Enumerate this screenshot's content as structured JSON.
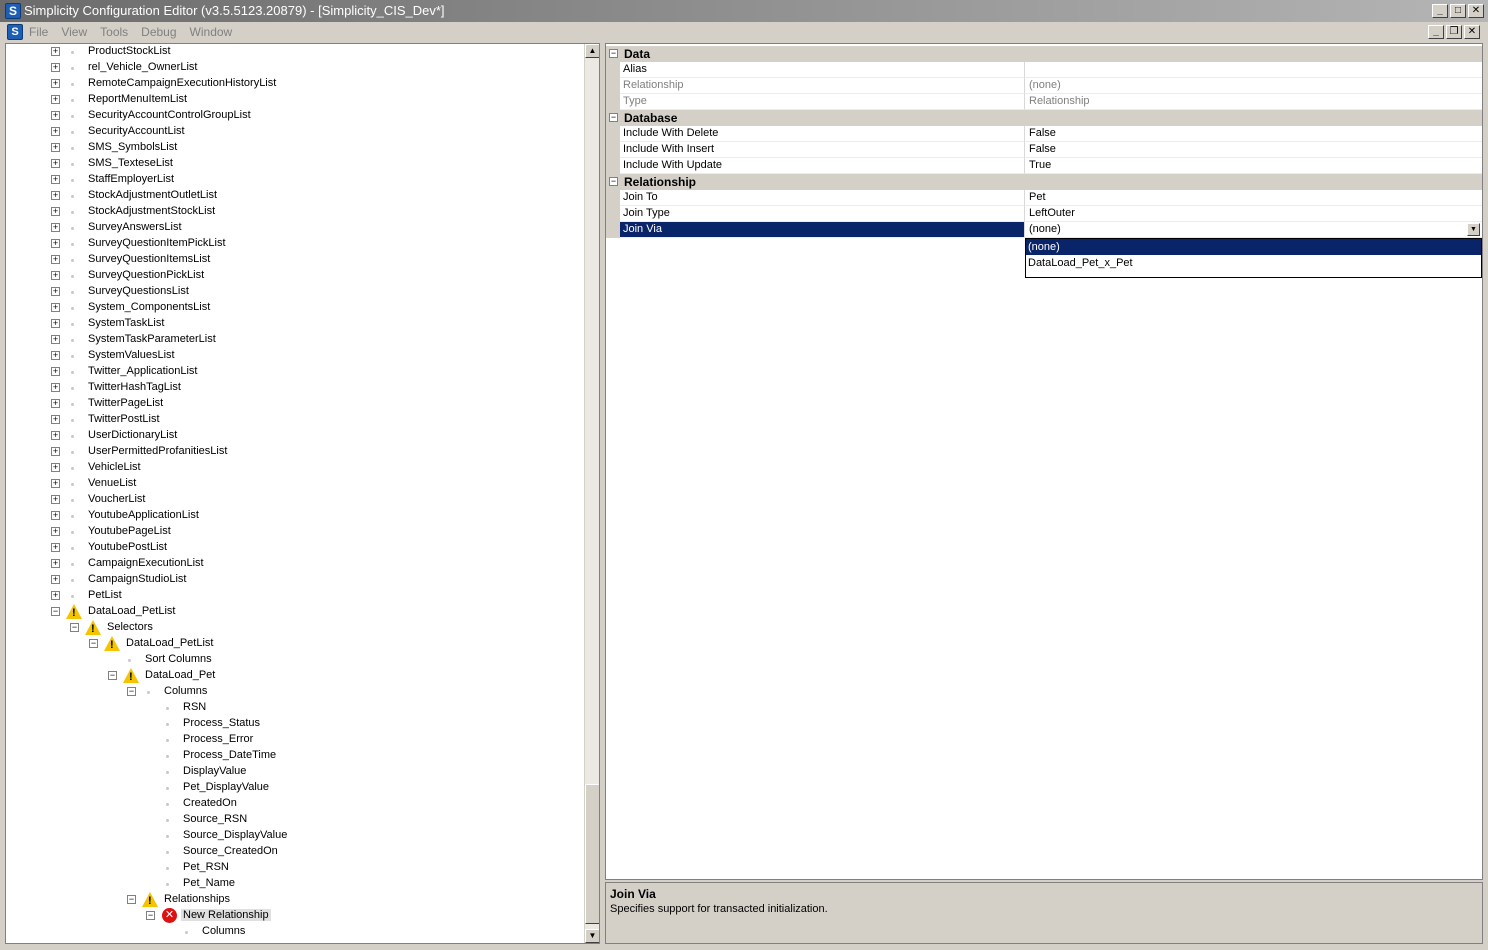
{
  "window": {
    "title": "Simplicity Configuration Editor (v3.5.5123.20879) - [Simplicity_CIS_Dev*]",
    "app_icon_letter": "S",
    "min": "_",
    "max": "□",
    "close": "✕",
    "child_min": "_",
    "child_restore": "❐",
    "child_close": "✕"
  },
  "menu": {
    "file": "File",
    "view": "View",
    "tools": "Tools",
    "debug": "Debug",
    "window": "Window"
  },
  "tree": {
    "expand_sym": "+",
    "collapse_sym": "−",
    "items": [
      {
        "label": "ProductStockList",
        "level": 0,
        "expander": "+",
        "icon": "bullet"
      },
      {
        "label": "rel_Vehicle_OwnerList",
        "level": 0,
        "expander": "+",
        "icon": "bullet"
      },
      {
        "label": "RemoteCampaignExecutionHistoryList",
        "level": 0,
        "expander": "+",
        "icon": "bullet"
      },
      {
        "label": "ReportMenuItemList",
        "level": 0,
        "expander": "+",
        "icon": "bullet"
      },
      {
        "label": "SecurityAccountControlGroupList",
        "level": 0,
        "expander": "+",
        "icon": "bullet"
      },
      {
        "label": "SecurityAccountList",
        "level": 0,
        "expander": "+",
        "icon": "bullet"
      },
      {
        "label": "SMS_SymbolsList",
        "level": 0,
        "expander": "+",
        "icon": "bullet"
      },
      {
        "label": "SMS_TexteseList",
        "level": 0,
        "expander": "+",
        "icon": "bullet"
      },
      {
        "label": "StaffEmployerList",
        "level": 0,
        "expander": "+",
        "icon": "bullet"
      },
      {
        "label": "StockAdjustmentOutletList",
        "level": 0,
        "expander": "+",
        "icon": "bullet"
      },
      {
        "label": "StockAdjustmentStockList",
        "level": 0,
        "expander": "+",
        "icon": "bullet"
      },
      {
        "label": "SurveyAnswersList",
        "level": 0,
        "expander": "+",
        "icon": "bullet"
      },
      {
        "label": "SurveyQuestionItemPickList",
        "level": 0,
        "expander": "+",
        "icon": "bullet"
      },
      {
        "label": "SurveyQuestionItemsList",
        "level": 0,
        "expander": "+",
        "icon": "bullet"
      },
      {
        "label": "SurveyQuestionPickList",
        "level": 0,
        "expander": "+",
        "icon": "bullet"
      },
      {
        "label": "SurveyQuestionsList",
        "level": 0,
        "expander": "+",
        "icon": "bullet"
      },
      {
        "label": "System_ComponentsList",
        "level": 0,
        "expander": "+",
        "icon": "bullet"
      },
      {
        "label": "SystemTaskList",
        "level": 0,
        "expander": "+",
        "icon": "bullet"
      },
      {
        "label": "SystemTaskParameterList",
        "level": 0,
        "expander": "+",
        "icon": "bullet"
      },
      {
        "label": "SystemValuesList",
        "level": 0,
        "expander": "+",
        "icon": "bullet"
      },
      {
        "label": "Twitter_ApplicationList",
        "level": 0,
        "expander": "+",
        "icon": "bullet"
      },
      {
        "label": "TwitterHashTagList",
        "level": 0,
        "expander": "+",
        "icon": "bullet"
      },
      {
        "label": "TwitterPageList",
        "level": 0,
        "expander": "+",
        "icon": "bullet"
      },
      {
        "label": "TwitterPostList",
        "level": 0,
        "expander": "+",
        "icon": "bullet"
      },
      {
        "label": "UserDictionaryList",
        "level": 0,
        "expander": "+",
        "icon": "bullet"
      },
      {
        "label": "UserPermittedProfanitiesList",
        "level": 0,
        "expander": "+",
        "icon": "bullet"
      },
      {
        "label": "VehicleList",
        "level": 0,
        "expander": "+",
        "icon": "bullet"
      },
      {
        "label": "VenueList",
        "level": 0,
        "expander": "+",
        "icon": "bullet"
      },
      {
        "label": "VoucherList",
        "level": 0,
        "expander": "+",
        "icon": "bullet"
      },
      {
        "label": "YoutubeApplicationList",
        "level": 0,
        "expander": "+",
        "icon": "bullet"
      },
      {
        "label": "YoutubePageList",
        "level": 0,
        "expander": "+",
        "icon": "bullet"
      },
      {
        "label": "YoutubePostList",
        "level": 0,
        "expander": "+",
        "icon": "bullet"
      },
      {
        "label": "CampaignExecutionList",
        "level": 0,
        "expander": "+",
        "icon": "bullet"
      },
      {
        "label": "CampaignStudioList",
        "level": 0,
        "expander": "+",
        "icon": "bullet"
      },
      {
        "label": "PetList",
        "level": 0,
        "expander": "+",
        "icon": "bullet"
      },
      {
        "label": "DataLoad_PetList",
        "level": 0,
        "expander": "−",
        "icon": "warning"
      },
      {
        "label": "Selectors",
        "level": 1,
        "expander": "−",
        "icon": "warning"
      },
      {
        "label": "DataLoad_PetList",
        "level": 2,
        "expander": "−",
        "icon": "warning"
      },
      {
        "label": "Sort Columns",
        "level": 3,
        "expander": "",
        "icon": "bullet"
      },
      {
        "label": "DataLoad_Pet",
        "level": 3,
        "expander": "−",
        "icon": "warning"
      },
      {
        "label": "Columns",
        "level": 4,
        "expander": "−",
        "icon": "bullet"
      },
      {
        "label": "RSN",
        "level": 5,
        "expander": "",
        "icon": "bullet"
      },
      {
        "label": "Process_Status",
        "level": 5,
        "expander": "",
        "icon": "bullet"
      },
      {
        "label": "Process_Error",
        "level": 5,
        "expander": "",
        "icon": "bullet"
      },
      {
        "label": "Process_DateTime",
        "level": 5,
        "expander": "",
        "icon": "bullet"
      },
      {
        "label": "DisplayValue",
        "level": 5,
        "expander": "",
        "icon": "bullet"
      },
      {
        "label": "Pet_DisplayValue",
        "level": 5,
        "expander": "",
        "icon": "bullet"
      },
      {
        "label": "CreatedOn",
        "level": 5,
        "expander": "",
        "icon": "bullet"
      },
      {
        "label": "Source_RSN",
        "level": 5,
        "expander": "",
        "icon": "bullet"
      },
      {
        "label": "Source_DisplayValue",
        "level": 5,
        "expander": "",
        "icon": "bullet"
      },
      {
        "label": "Source_CreatedOn",
        "level": 5,
        "expander": "",
        "icon": "bullet"
      },
      {
        "label": "Pet_RSN",
        "level": 5,
        "expander": "",
        "icon": "bullet"
      },
      {
        "label": "Pet_Name",
        "level": 5,
        "expander": "",
        "icon": "bullet"
      },
      {
        "label": "Relationships",
        "level": 4,
        "expander": "−",
        "icon": "warning"
      },
      {
        "label": "New Relationship",
        "level": 5,
        "expander": "−",
        "icon": "error",
        "selected": true
      },
      {
        "label": "Columns",
        "level": 6,
        "expander": "",
        "icon": "bullet"
      }
    ]
  },
  "properties": {
    "rows": [
      {
        "kind": "category",
        "label": "Data"
      },
      {
        "kind": "prop",
        "name": "Alias",
        "value": "",
        "dim": false
      },
      {
        "kind": "prop",
        "name": "Relationship",
        "value": "(none)",
        "dim": true
      },
      {
        "kind": "prop",
        "name": "Type",
        "value": "Relationship",
        "dim": true
      },
      {
        "kind": "category",
        "label": "Database"
      },
      {
        "kind": "prop",
        "name": "Include With Delete",
        "value": "False",
        "dim": false
      },
      {
        "kind": "prop",
        "name": "Include With Insert",
        "value": "False",
        "dim": false
      },
      {
        "kind": "prop",
        "name": "Include With Update",
        "value": "True",
        "dim": false
      },
      {
        "kind": "category",
        "label": "Relationship"
      },
      {
        "kind": "prop",
        "name": "Join To",
        "value": "Pet",
        "dim": false
      },
      {
        "kind": "prop",
        "name": "Join Type",
        "value": "LeftOuter",
        "dim": false
      },
      {
        "kind": "prop",
        "name": "Join Via",
        "value": "(none)",
        "dim": false,
        "selected": true
      }
    ],
    "dropdown_options": [
      "(none)",
      "DataLoad_Pet_x_Pet"
    ],
    "dropdown_selected": 0,
    "dropdown_arrow": "▼"
  },
  "help": {
    "title": "Join Via",
    "description": "Specifies support for transacted initialization."
  },
  "colors": {
    "selection": "#0a246a",
    "warning": "#f5c400",
    "error": "#dd1111"
  }
}
